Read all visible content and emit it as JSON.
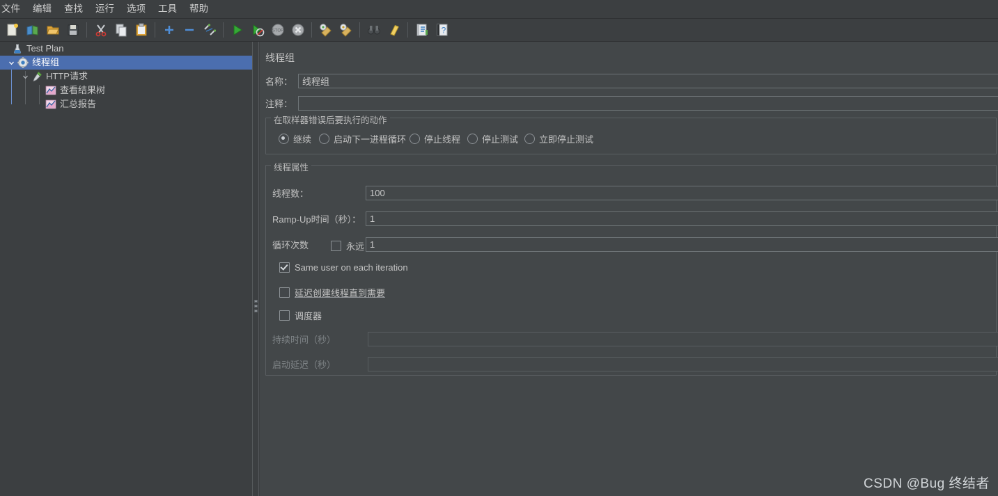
{
  "menu": {
    "items": [
      {
        "label": "文件"
      },
      {
        "label": "编辑"
      },
      {
        "label": "查找"
      },
      {
        "label": "运行"
      },
      {
        "label": "选项"
      },
      {
        "label": "工具"
      },
      {
        "label": "帮助"
      }
    ]
  },
  "toolbar": {
    "buttons": [
      {
        "name": "new-test-plan",
        "icon": "new-file-icon"
      },
      {
        "name": "templates",
        "icon": "templates-icon"
      },
      {
        "name": "open",
        "icon": "open-folder-icon"
      },
      {
        "name": "save",
        "icon": "save-disk-icon"
      },
      {
        "name": "cut",
        "icon": "scissors-icon"
      },
      {
        "name": "copy",
        "icon": "copy-icon"
      },
      {
        "name": "paste",
        "icon": "clipboard-icon"
      },
      {
        "name": "expand-all",
        "icon": "plus-icon"
      },
      {
        "name": "collapse-all",
        "icon": "minus-icon"
      },
      {
        "name": "toggle",
        "icon": "toggle-pencil-icon"
      },
      {
        "name": "start",
        "icon": "green-play-icon"
      },
      {
        "name": "start-no-pauses",
        "icon": "play-no-pause-icon"
      },
      {
        "name": "stop",
        "icon": "stop-icon"
      },
      {
        "name": "shutdown",
        "icon": "shutdown-icon"
      },
      {
        "name": "clear",
        "icon": "clear-broom-icon"
      },
      {
        "name": "clear-all",
        "icon": "clear-all-broom-icon"
      },
      {
        "name": "search",
        "icon": "binoculars-icon"
      },
      {
        "name": "reset-search",
        "icon": "reset-broom-icon"
      },
      {
        "name": "function-helper",
        "icon": "function-helper-icon"
      },
      {
        "name": "help",
        "icon": "help-question-icon"
      }
    ]
  },
  "tree": {
    "nodes": [
      {
        "label": "Test Plan",
        "icon": "test-plan-flask-icon",
        "depth": 0,
        "toggle": "",
        "selected": false
      },
      {
        "label": "线程组",
        "icon": "thread-group-gear-icon",
        "depth": 1,
        "toggle": "v",
        "selected": true
      },
      {
        "label": "HTTP请求",
        "icon": "http-request-pipette-icon",
        "depth": 2,
        "toggle": "v",
        "selected": false
      },
      {
        "label": "查看结果树",
        "icon": "view-results-tree-chart-icon",
        "depth": 3,
        "toggle": "",
        "selected": false
      },
      {
        "label": "汇总报告",
        "icon": "summary-report-chart-icon",
        "depth": 3,
        "toggle": "",
        "selected": false
      }
    ]
  },
  "panel": {
    "title": "线程组",
    "name_label": "名称：",
    "name_value": "线程组",
    "comment_label": "注释：",
    "comment_value": "",
    "error_action": {
      "title": "在取样器错误后要执行的动作",
      "options": [
        {
          "label": "继续",
          "checked": true
        },
        {
          "label": "启动下一进程循环",
          "checked": false
        },
        {
          "label": "停止线程",
          "checked": false
        },
        {
          "label": "停止测试",
          "checked": false
        },
        {
          "label": "立即停止测试",
          "checked": false
        }
      ]
    },
    "thread_props": {
      "title": "线程属性",
      "threads_label": "线程数：",
      "threads_value": "100",
      "rampup_label": "Ramp-Up时间（秒）：",
      "rampup_value": "1",
      "loop_label": "循环次数",
      "forever_label": "永远",
      "forever_checked": false,
      "loop_value": "1",
      "same_user_label": "Same user on each iteration",
      "same_user_checked": true,
      "delayed_start_label": "延迟创建线程直到需要",
      "delayed_start_checked": false,
      "scheduler_label": "调度器",
      "scheduler_checked": false,
      "duration_label": "持续时间（秒）",
      "duration_value": "",
      "startup_delay_label": "启动延迟（秒）",
      "startup_delay_value": ""
    }
  },
  "watermark": {
    "text": "CSDN @Bug 终结者"
  },
  "colors": {
    "window_bg": "#3c3f41",
    "panel_bg": "#434749",
    "selection_blue": "#4b6eaf",
    "text": "#c3c3c3",
    "border": "#5a5f62"
  }
}
